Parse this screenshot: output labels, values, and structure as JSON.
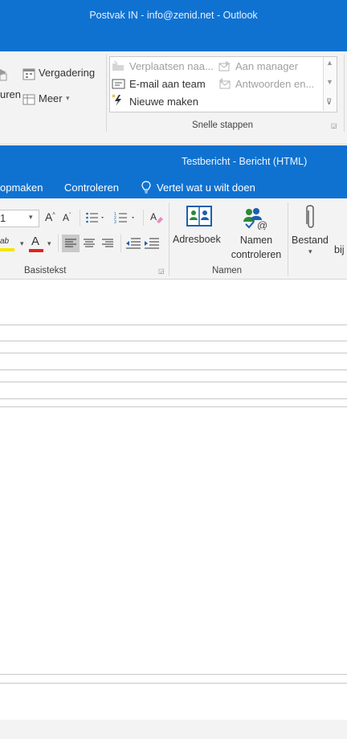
{
  "outlook_window": {
    "title": "Postvak IN - info@zenid.net - Outlook",
    "ribbon": {
      "partial_label_left": "uren",
      "meeting_label": "Vergadering",
      "more_label": "Meer",
      "quick_steps": {
        "items": [
          {
            "label": "Verplaatsen naa...",
            "enabled": false
          },
          {
            "label": "Aan manager",
            "enabled": false
          },
          {
            "label": "E-mail aan team",
            "enabled": true
          },
          {
            "label": "Antwoorden en...",
            "enabled": false
          },
          {
            "label": "Nieuwe maken",
            "enabled": true
          }
        ],
        "caption": "Snelle stappen"
      }
    }
  },
  "compose_window": {
    "title": "Testbericht - Bericht (HTML)",
    "tabs": [
      "opmaken",
      "Controleren"
    ],
    "tell_me": "Vertel wat u wilt doen",
    "basic_text": {
      "font_size": "1",
      "caption": "Basistekst"
    },
    "names": {
      "address_book": "Adresboek",
      "check_names_line1": "Namen",
      "check_names_line2": "controleren",
      "caption": "Namen"
    },
    "attach": {
      "label": "Bestand",
      "partial": "bij"
    }
  },
  "colors": {
    "title_blue": "#0f72d1",
    "ribbon_bg": "#f3f3f3",
    "highlight_yellow": "#f5e500",
    "font_red": "#e2231a"
  }
}
